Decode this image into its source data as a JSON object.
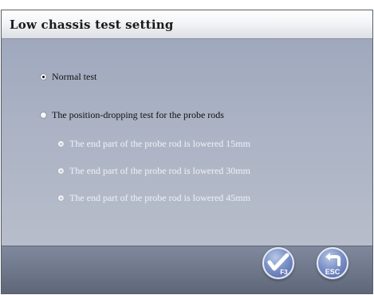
{
  "caption": "Normal test",
  "window": {
    "title": "Low chassis test setting"
  },
  "options": {
    "normal_test": {
      "label": "Normal test",
      "checked": true,
      "enabled": true
    },
    "position_dropping": {
      "label": "The position-dropping test for the probe rods",
      "checked": false,
      "enabled": true
    },
    "sub_15": {
      "label": "The end part of the probe rod is lowered 15mm",
      "checked": false,
      "enabled": false
    },
    "sub_30": {
      "label": "The end part of the probe rod is lowered 30mm",
      "checked": false,
      "enabled": false
    },
    "sub_45": {
      "label": "The end part of the probe rod is lowered 45mm",
      "checked": false,
      "enabled": false
    }
  },
  "buttons": {
    "confirm": {
      "key": "F3",
      "icon": "checkmark-icon"
    },
    "escape": {
      "key": "ESC",
      "icon": "return-arrow-icon"
    }
  },
  "colors": {
    "content_bg": "#aab2c4",
    "bottom_bar": "#6d7689",
    "button_blue": "#7d92c8",
    "disabled_text": "#e9ecf2"
  }
}
